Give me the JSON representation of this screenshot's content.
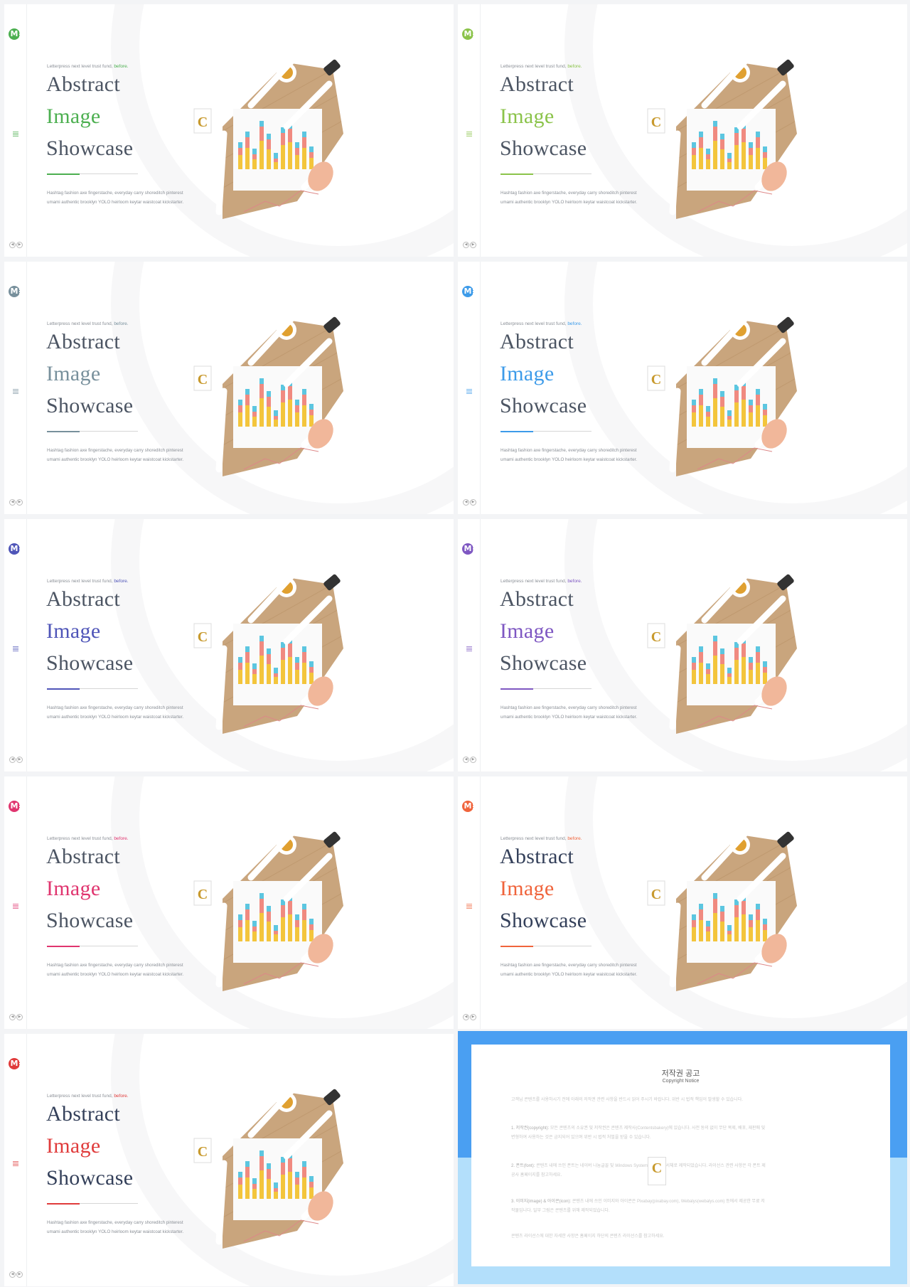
{
  "slides": [
    {
      "accent": "#4caf50",
      "kicker": "Letterpress next level trust fund,",
      "kicker_accent": "before.",
      "title1": "Abstract",
      "title2": "Image",
      "title3": "Showcase",
      "body": "Hashtag fashion axe fingerstache, everyday carry shoreditch pinterest umami authentic brooklyn YOLO heirloom keytar waistcoat kickstarter.",
      "title_color": "#4c5563"
    },
    {
      "accent": "#8bc34a",
      "kicker": "Letterpress next level trust fund,",
      "kicker_accent": "before.",
      "title1": "Abstract",
      "title2": "Image",
      "title3": "Showcase",
      "body": "Hashtag fashion axe fingerstache, everyday carry shoreditch pinterest umami authentic brooklyn YOLO heirloom keytar waistcoat kickstarter.",
      "title_color": "#4c5563"
    },
    {
      "accent": "#78909c",
      "kicker": "Letterpress next level trust fund,",
      "kicker_accent": "before.",
      "title1": "Abstract",
      "title2": "Image",
      "title3": "Showcase",
      "body": "Hashtag fashion axe fingerstache, everyday carry shoreditch pinterest umami authentic brooklyn YOLO heirloom keytar waistcoat kickstarter.",
      "title_color": "#4c5563"
    },
    {
      "accent": "#3d9be9",
      "kicker": "Letterpress next level trust fund,",
      "kicker_accent": "before.",
      "title1": "Abstract",
      "title2": "Image",
      "title3": "Showcase",
      "body": "Hashtag fashion axe fingerstache, everyday carry shoreditch pinterest umami authentic brooklyn YOLO heirloom keytar waistcoat kickstarter.",
      "title_color": "#4c5563"
    },
    {
      "accent": "#4f55b8",
      "kicker": "Letterpress next level trust fund,",
      "kicker_accent": "before.",
      "title1": "Abstract",
      "title2": "Image",
      "title3": "Showcase",
      "body": "Hashtag fashion axe fingerstache, everyday carry shoreditch pinterest umami authentic brooklyn YOLO heirloom keytar waistcoat kickstarter.",
      "title_color": "#4c5563"
    },
    {
      "accent": "#7e57c2",
      "kicker": "Letterpress next level trust fund,",
      "kicker_accent": "before.",
      "title1": "Abstract",
      "title2": "Image",
      "title3": "Showcase",
      "body": "Hashtag fashion axe fingerstache, everyday carry shoreditch pinterest umami authentic brooklyn YOLO heirloom keytar waistcoat kickstarter.",
      "title_color": "#4c5563"
    },
    {
      "accent": "#e0356f",
      "kicker": "Letterpress next level trust fund,",
      "kicker_accent": "before.",
      "title1": "Abstract",
      "title2": "Image",
      "title3": "Showcase",
      "body": "Hashtag fashion axe fingerstache, everyday carry shoreditch pinterest umami authentic brooklyn YOLO heirloom keytar waistcoat kickstarter.",
      "title_color": "#4c5563"
    },
    {
      "accent": "#f0643c",
      "kicker": "Letterpress next level trust fund,",
      "kicker_accent": "before.",
      "title1": "Abstract",
      "title2": "Image",
      "title3": "Showcase",
      "body": "Hashtag fashion axe fingerstache, everyday carry shoreditch pinterest umami authentic brooklyn YOLO heirloom keytar waistcoat kickstarter.",
      "title_color": "#34405a"
    },
    {
      "accent": "#e03b3b",
      "kicker": "Letterpress next level trust fund,",
      "kicker_accent": "before.",
      "title1": "Abstract",
      "title2": "Image",
      "title3": "Showcase",
      "body": "Hashtag fashion axe fingerstache, everyday carry shoreditch pinterest umami authentic brooklyn YOLO heirloom keytar waistcoat kickstarter.",
      "title_color": "#34405a"
    }
  ],
  "notice": {
    "title_ko": "저작권 공고",
    "title_en": "Copyright Notice",
    "intro": "고객님 콘텐츠를 사용하시기 전에 아래의 저작권 관련 사항을 반드시 읽어 주시기 바랍니다. 위반 시 법적 책임이 발생할 수 있습니다.",
    "p1_label": "1. 저작권(copyright):",
    "p1": "모든 콘텐츠의 소유권 및 저작권은 콘텐츠 제작사(Contentsbakery)에 있습니다. 사전 동의 없이 무단 복제, 배포, 재판매 및 변형하여 사용하는 것은 금지되어 있으며 위반 시 법적 처벌을 받을 수 있습니다.",
    "p2_label": "2. 폰트(font):",
    "p2": "콘텐츠 내에 쓰인 폰트는 네이버 나눔글꼴 및 Windows System에 포함된 서체로 제작되었습니다. 라이선스 관련 사항은 각 폰트 제공사 홈페이지를 참고하세요.",
    "p3_label": "3. 이미지(image) & 아이콘(icon):",
    "p3": "콘텐츠 내에 쓰인 이미지와 아이콘은 Pixabay(pixabay.com), Webalys(webalys.com) 등에서 제공한 무료 저작물입니다. 일부 그림은 콘텐츠를 위해 제작되었습니다.",
    "outro": "콘텐츠 라이선스에 대한 자세한 사항은 홈페이지 하단의 콘텐츠 라이선스를 참고하세요."
  }
}
